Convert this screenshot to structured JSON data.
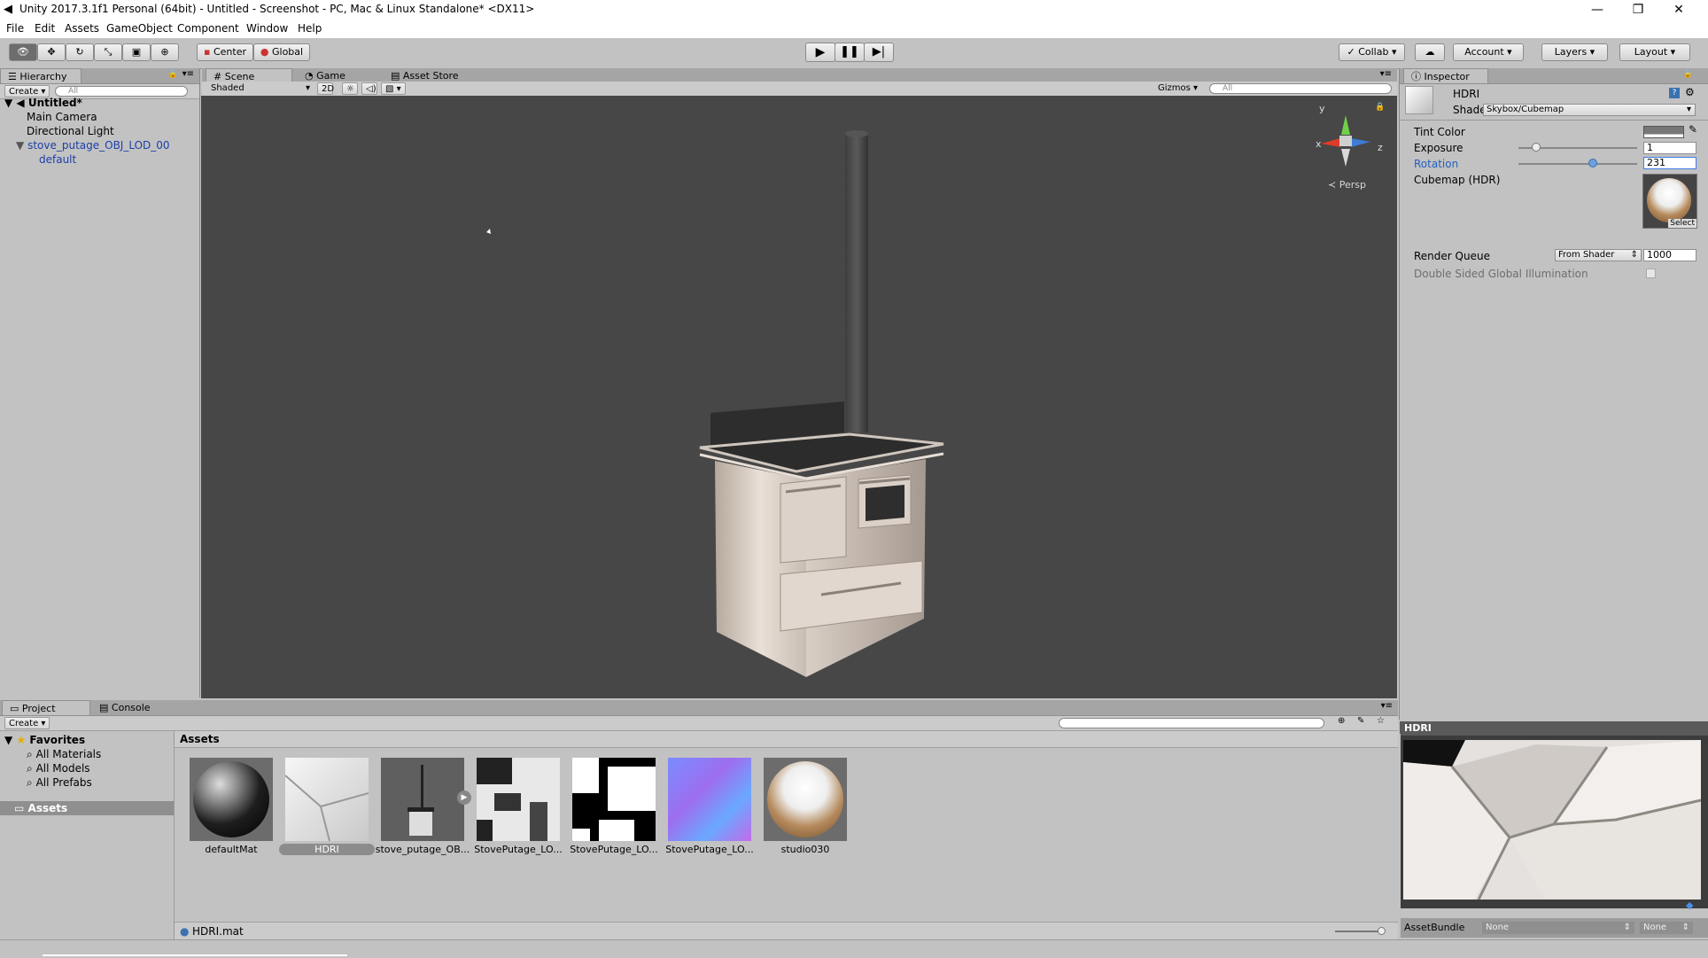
{
  "window": {
    "title": "Unity 2017.3.1f1 Personal (64bit) - Untitled - Screenshot - PC, Mac & Linux Standalone* <DX11>",
    "minimize": "—",
    "maximize": "❐",
    "close": "✕"
  },
  "menu": [
    "File",
    "Edit",
    "Assets",
    "GameObject",
    "Component",
    "Window",
    "Help"
  ],
  "toolbar": {
    "pivot": "Center",
    "space": "Global",
    "collab": "Collab",
    "account": "Account",
    "layers": "Layers",
    "layout": "Layout"
  },
  "hierarchy": {
    "tab": "Hierarchy",
    "create": "Create",
    "search_placeholder": "All",
    "scene": "Untitled*",
    "items": [
      "Main Camera",
      "Directional Light",
      "stove_putage_OBJ_LOD_00",
      "default"
    ]
  },
  "scene": {
    "tabs": [
      "Scene",
      "Game",
      "Asset Store"
    ],
    "shading": "Shaded",
    "mode2d": "2D",
    "gizmos": "Gizmos",
    "search_placeholder": "All",
    "persp": "Persp",
    "axis_y": "y",
    "axis_x": "x",
    "axis_z": "z"
  },
  "inspector": {
    "tab": "Inspector",
    "name": "HDRI",
    "shader_label": "Shader",
    "shader_value": "Skybox/Cubemap",
    "tint_label": "Tint Color",
    "exposure_label": "Exposure",
    "exposure_value": "1",
    "exposure_level": 0.12,
    "rotation_label": "Rotation",
    "rotation_value": "231",
    "rotation_level": 0.64,
    "cubemap_label": "Cubemap   (HDR)",
    "select": "Select",
    "render_queue_label": "Render Queue",
    "render_queue_mode": "From Shader",
    "render_queue_value": "1000",
    "double_sided_label": "Double Sided Global Illumination",
    "preview_title": "HDRI",
    "assetbundle_label": "AssetBundle",
    "assetbundle_value": "None",
    "assetbundle_variant": "None"
  },
  "project": {
    "tabs": [
      "Project",
      "Console"
    ],
    "create": "Create",
    "favorites": "Favorites",
    "favorite_items": [
      "All Materials",
      "All Models",
      "All Prefabs"
    ],
    "assets_folder": "Assets",
    "breadcrumb": "Assets",
    "assets": [
      "defaultMat",
      "HDRI",
      "stove_putage_OB...",
      "StovePutage_LO...",
      "StovePutage_LO...",
      "StovePutage_LO...",
      "studio030"
    ],
    "selected_file": "HDRI.mat"
  },
  "colors": {
    "accent": "#3a72b0",
    "selection": "#3e7de7",
    "scene_bg": "#474747"
  }
}
